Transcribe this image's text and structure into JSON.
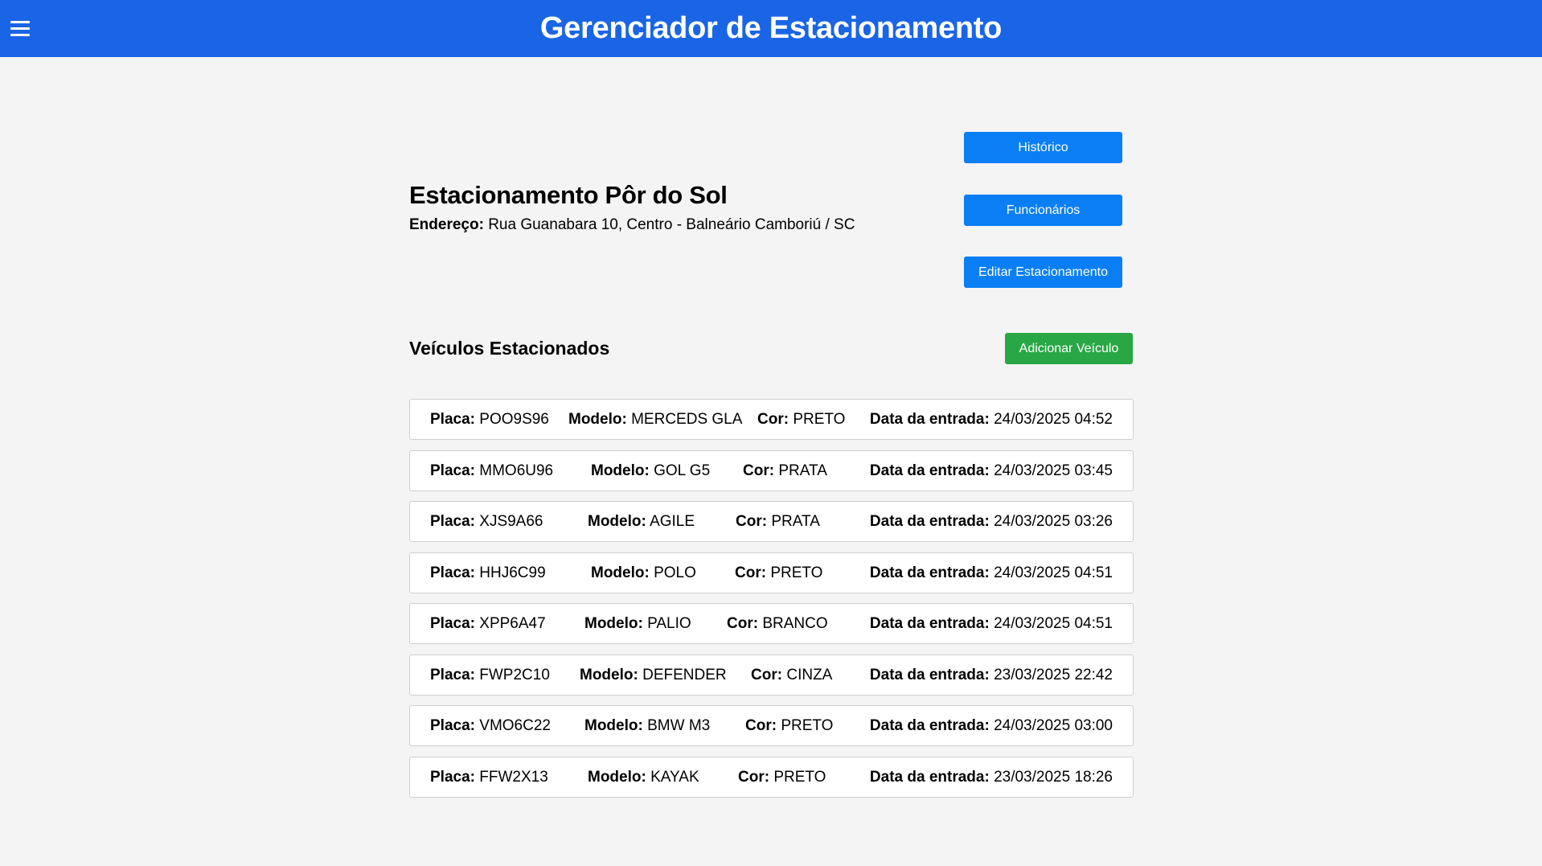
{
  "header": {
    "title": "Gerenciador de Estacionamento",
    "menu_icon": "hamburger-menu-icon"
  },
  "actions": {
    "historico": "Histórico",
    "funcionarios": "Funcionários",
    "editar": "Editar Estacionamento",
    "adicionar_veiculo": "Adicionar Veículo"
  },
  "lot": {
    "name": "Estacionamento Pôr do Sol",
    "address_label": "Endereço:",
    "address": "Rua Guanabara 10, Centro - Balneário Camboriú / SC"
  },
  "section": {
    "title": "Veículos Estacionados"
  },
  "labels": {
    "placa": "Placa:",
    "modelo": "Modelo:",
    "cor": "Cor:",
    "data": "Data da entrada:"
  },
  "vehicles": [
    {
      "placa": "POO9S96",
      "modelo": "MERCEDS GLA",
      "cor": "PRETO",
      "data": "24/03/2025 04:52"
    },
    {
      "placa": "MMO6U96",
      "modelo": "GOL G5",
      "cor": "PRATA",
      "data": "24/03/2025 03:45"
    },
    {
      "placa": "XJS9A66",
      "modelo": "AGILE",
      "cor": "PRATA",
      "data": "24/03/2025 03:26"
    },
    {
      "placa": "HHJ6C99",
      "modelo": "POLO",
      "cor": "PRETO",
      "data": "24/03/2025 04:51"
    },
    {
      "placa": "XPP6A47",
      "modelo": "PALIO",
      "cor": "BRANCO",
      "data": "24/03/2025 04:51"
    },
    {
      "placa": "FWP2C10",
      "modelo": "DEFENDER",
      "cor": "CINZA",
      "data": "23/03/2025 22:42"
    },
    {
      "placa": "VMO6C22",
      "modelo": "BMW M3",
      "cor": "PRETO",
      "data": "24/03/2025 03:00"
    },
    {
      "placa": "FFW2X13",
      "modelo": "KAYAK",
      "cor": "PRETO",
      "data": "23/03/2025 18:26"
    }
  ],
  "colors": {
    "header": "#1a65e6",
    "primary_button": "#0a7ff5",
    "success_button": "#29a745"
  }
}
